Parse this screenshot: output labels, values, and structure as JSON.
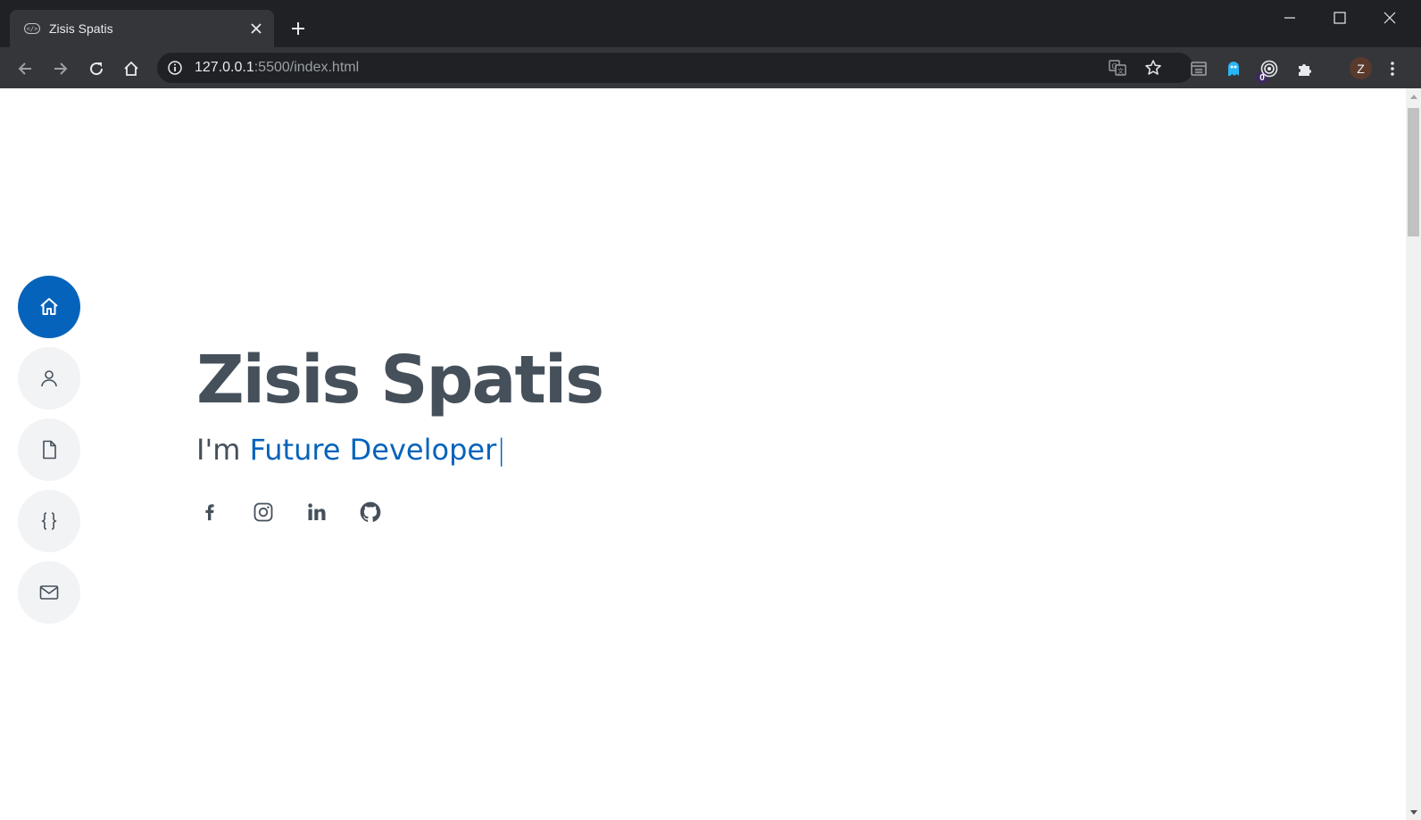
{
  "browser": {
    "tab_title": "Zisis Spatis",
    "url_host": "127.0.0.1",
    "url_rest": ":5500/index.html",
    "extension_badge": "0",
    "profile_initial": "Z"
  },
  "page": {
    "name": "Zisis Spatis",
    "intro_prefix": "I'm",
    "intro_role": "Future Developer",
    "cursor": "|",
    "accent_color": "#0563bb",
    "text_color": "#45505b",
    "nav_items": [
      "home-icon",
      "person-icon",
      "document-icon",
      "code-braces-icon",
      "mail-icon"
    ],
    "socials": [
      "facebook-icon",
      "instagram-icon",
      "linkedin-icon",
      "github-icon"
    ]
  }
}
